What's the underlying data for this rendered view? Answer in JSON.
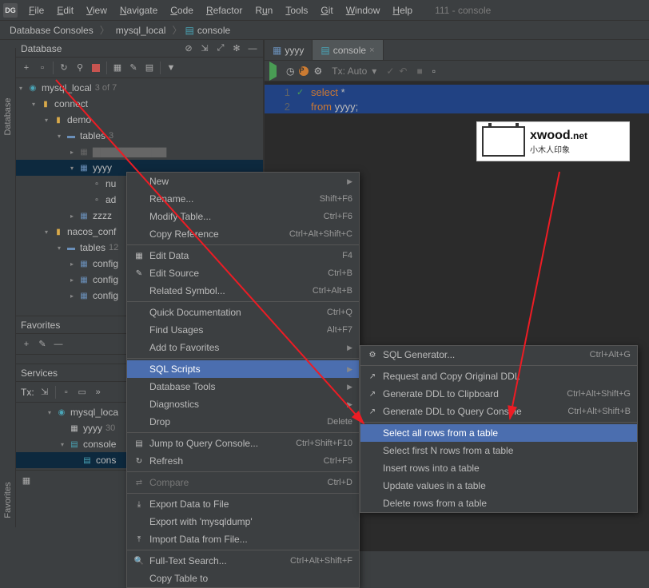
{
  "window_title": "111 - console",
  "menubar": [
    "File",
    "Edit",
    "View",
    "Navigate",
    "Code",
    "Refactor",
    "Run",
    "Tools",
    "Git",
    "Window",
    "Help"
  ],
  "breadcrumb": [
    "Database Consoles",
    "mysql_local",
    "console"
  ],
  "side_tabs": {
    "database": "Database",
    "favorites": "Favorites"
  },
  "db_panel": {
    "title": "Database",
    "tree": {
      "root": {
        "label": "mysql_local",
        "count": "3 of 7"
      },
      "connect": "connect",
      "demo": "demo",
      "tables": "tables",
      "tables_count": "3",
      "yyyy": "yyyy",
      "nu": "nu",
      "ad": "ad",
      "zzzz": "zzzz",
      "nacos_conf": "nacos_conf",
      "tables2": "tables",
      "tables2_count": "12",
      "configs": [
        "config",
        "config",
        "config"
      ]
    }
  },
  "fav_panel": {
    "title": "Favorites"
  },
  "svc_panel": {
    "title": "Services",
    "tx": "Tx:",
    "mysql_loc": "mysql_loca",
    "yyyy": "yyyy",
    "yyyy_count": "30",
    "console": "console",
    "cons": "cons"
  },
  "editor": {
    "tabs": [
      {
        "label": "yyyy"
      },
      {
        "label": "console"
      }
    ],
    "tx_auto": "Tx: Auto",
    "lines": [
      {
        "n": "1",
        "code": [
          {
            "t": "select",
            "kw": true
          },
          {
            "t": " *"
          }
        ]
      },
      {
        "n": "2",
        "code": [
          {
            "t": "from",
            "kw": true
          },
          {
            "t": " yyyy;"
          }
        ]
      }
    ]
  },
  "logo": {
    "main": "xwood",
    "suffix": ".net",
    "sub": "小木人印象"
  },
  "menu1": [
    {
      "t": "New",
      "arr": true
    },
    {
      "t": "Rename...",
      "sc": "Shift+F6"
    },
    {
      "t": "Modify Table...",
      "sc": "Ctrl+F6"
    },
    {
      "t": "Copy Reference",
      "sc": "Ctrl+Alt+Shift+C"
    },
    {
      "sep": true
    },
    {
      "t": "Edit Data",
      "ic": "▦",
      "sc": "F4"
    },
    {
      "t": "Edit Source",
      "ic": "✎",
      "sc": "Ctrl+B"
    },
    {
      "t": "Related Symbol...",
      "sc": "Ctrl+Alt+B"
    },
    {
      "sep": true
    },
    {
      "t": "Quick Documentation",
      "sc": "Ctrl+Q"
    },
    {
      "t": "Find Usages",
      "sc": "Alt+F7"
    },
    {
      "t": "Add to Favorites",
      "arr": true
    },
    {
      "sep": true
    },
    {
      "t": "SQL Scripts",
      "arr": true,
      "hl": true
    },
    {
      "t": "Database Tools",
      "arr": true
    },
    {
      "t": "Diagnostics",
      "arr": true
    },
    {
      "t": "Drop",
      "sc": "Delete"
    },
    {
      "sep": true
    },
    {
      "t": "Jump to Query Console...",
      "ic": "▤",
      "sc": "Ctrl+Shift+F10"
    },
    {
      "t": "Refresh",
      "ic": "↻",
      "sc": "Ctrl+F5"
    },
    {
      "sep": true
    },
    {
      "t": "Compare",
      "ic": "⇄",
      "sc": "Ctrl+D",
      "dim": true
    },
    {
      "sep": true
    },
    {
      "t": "Export Data to File",
      "ic": "⤓"
    },
    {
      "t": "Export with 'mysqldump'"
    },
    {
      "t": "Import Data from File...",
      "ic": "⤒"
    },
    {
      "sep": true
    },
    {
      "t": "Full-Text Search...",
      "ic": "🔍",
      "sc": "Ctrl+Alt+Shift+F"
    },
    {
      "t": "Copy Table to"
    }
  ],
  "menu2": [
    {
      "t": "SQL Generator...",
      "ic": "⚙",
      "sc": "Ctrl+Alt+G"
    },
    {
      "sep": true
    },
    {
      "t": "Request and Copy Original DDL",
      "ic": "↗"
    },
    {
      "t": "Generate DDL to Clipboard",
      "ic": "↗",
      "sc": "Ctrl+Alt+Shift+G"
    },
    {
      "t": "Generate DDL to Query Console",
      "ic": "↗",
      "sc": "Ctrl+Alt+Shift+B"
    },
    {
      "sep": true
    },
    {
      "t": "Select all rows from a table",
      "hl": true
    },
    {
      "t": "Select first N rows from a table"
    },
    {
      "t": "Insert rows into a table"
    },
    {
      "t": "Update values in a table"
    },
    {
      "t": "Delete rows from a table"
    }
  ]
}
